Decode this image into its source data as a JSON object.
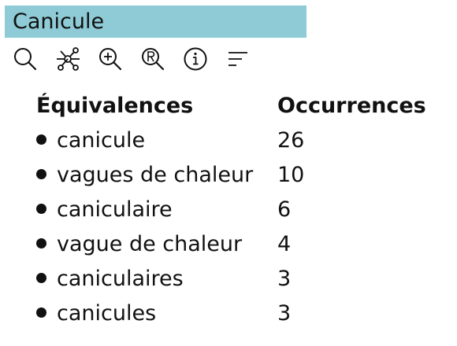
{
  "title": "Canicule",
  "toolbar": {
    "icons": [
      "search-icon",
      "network-graph-icon",
      "zoom-in-icon",
      "registered-search-icon",
      "info-icon",
      "sort-lines-icon"
    ]
  },
  "colors": {
    "title_bar": "#8ecbd6",
    "text": "#111111"
  },
  "table": {
    "headers": {
      "term": "Équivalences",
      "count": "Occurrences"
    },
    "rows": [
      {
        "term": "canicule",
        "count": "26"
      },
      {
        "term": "vagues de chaleur",
        "count": "10"
      },
      {
        "term": "caniculaire",
        "count": "6"
      },
      {
        "term": "vague de chaleur",
        "count": "4"
      },
      {
        "term": "caniculaires",
        "count": "3"
      },
      {
        "term": "canicules",
        "count": "3"
      }
    ]
  }
}
